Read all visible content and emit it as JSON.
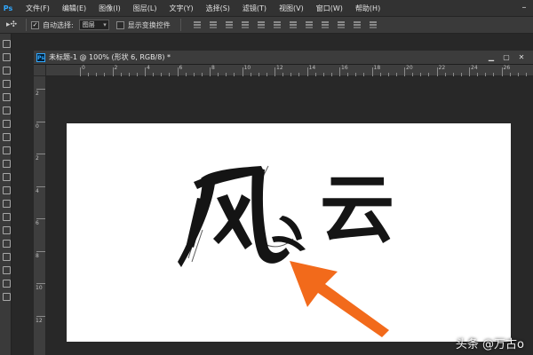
{
  "menubar": {
    "app_logo": "Ps",
    "items": [
      "文件(F)",
      "编辑(E)",
      "图像(I)",
      "图层(L)",
      "文字(Y)",
      "选择(S)",
      "滤镜(T)",
      "视图(V)",
      "窗口(W)",
      "帮助(H)"
    ]
  },
  "options": {
    "auto_select_label": "自动选择:",
    "auto_select_value": "图层",
    "show_transform_label": "显示变换控件"
  },
  "document": {
    "title": "未标题-1 @ 100% (形状 6, RGB/8) *"
  },
  "ruler": {
    "h_labels": [
      "0",
      "2",
      "4",
      "6",
      "8",
      "10",
      "12",
      "14",
      "16",
      "18",
      "20",
      "22",
      "24",
      "26"
    ],
    "v_labels": [
      "2",
      "0",
      "2",
      "4",
      "6",
      "8",
      "10",
      "12",
      "14"
    ]
  },
  "canvas": {
    "text_yun": "云"
  },
  "watermark": "头条 @万古o",
  "colors": {
    "arrow": "#f26a1b",
    "accent": "#31a8ff"
  }
}
